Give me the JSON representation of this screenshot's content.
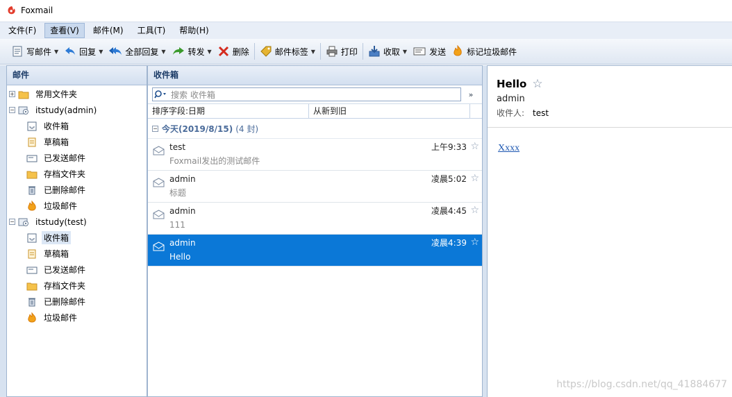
{
  "app": {
    "title": "Foxmail"
  },
  "menu": [
    "文件(F)",
    "查看(V)",
    "邮件(M)",
    "工具(T)",
    "帮助(H)"
  ],
  "toolbar": {
    "compose": "写邮件",
    "reply": "回复",
    "reply_all": "全部回复",
    "forward": "转发",
    "delete": "删除",
    "tag": "邮件标签",
    "print": "打印",
    "receive": "收取",
    "send": "发送",
    "spam": "标记垃圾邮件"
  },
  "left": {
    "header": "邮件",
    "common_folder": "常用文件夹",
    "accounts": [
      {
        "name": "itstudy(admin)",
        "folders": [
          "收件箱",
          "草稿箱",
          "已发送邮件",
          "存档文件夹",
          "已删除邮件",
          "垃圾邮件"
        ]
      },
      {
        "name": "itstudy(test)",
        "folders": [
          "收件箱",
          "草稿箱",
          "已发送邮件",
          "存档文件夹",
          "已删除邮件",
          "垃圾邮件"
        ]
      }
    ]
  },
  "mid": {
    "header": "收件箱",
    "search_placeholder": "搜索 收件箱",
    "sort_field": "排序字段:日期",
    "sort_order": "从新到旧",
    "group": {
      "label": "今天(2019/8/15)",
      "count": "(4 封)"
    },
    "messages": [
      {
        "from": "test",
        "subject": "Foxmail发出的测试邮件",
        "time": "上午9:33",
        "selected": false
      },
      {
        "from": "admin",
        "subject": "标题",
        "time": "凌晨5:02",
        "selected": false
      },
      {
        "from": "admin",
        "subject": "111",
        "time": "凌晨4:45",
        "selected": false
      },
      {
        "from": "admin",
        "subject": "Hello",
        "time": "凌晨4:39",
        "selected": true
      }
    ]
  },
  "reader": {
    "subject": "Hello",
    "from": "admin",
    "to_label": "收件人:",
    "to_value": "test",
    "body_link": "Xxxx"
  },
  "watermark": "https://blog.csdn.net/qq_41884677",
  "colors": {
    "selection": "#0b78d7",
    "accent": "#e23c2c"
  }
}
